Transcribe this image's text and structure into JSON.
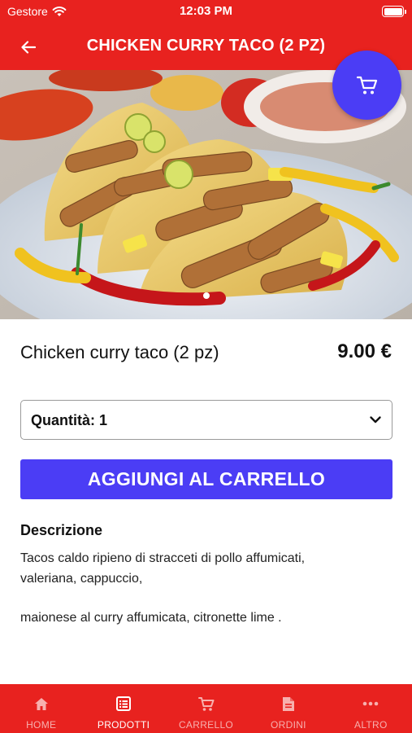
{
  "status_bar": {
    "carrier": "Gestore",
    "time": "12:03 PM"
  },
  "header": {
    "title": "CHICKEN CURRY TACO (2 PZ)",
    "back_icon": "back-arrow-icon"
  },
  "cart_button": {
    "icon": "cart-icon"
  },
  "product": {
    "name": "Chicken curry taco (2 pz)",
    "price": "9.00 €"
  },
  "quantity": {
    "label": "Quantità: 1"
  },
  "actions": {
    "add_to_cart_label": "AGGIUNGI AL CARRELLO"
  },
  "description": {
    "title": "Descrizione",
    "lines": [
      "Tacos caldo ripieno di  stracceti di pollo affumicati,",
      "valeriana, cappuccio,",
      "maionese al curry affumicata, citronette lime ."
    ]
  },
  "tabs": [
    {
      "label": "HOME",
      "icon": "home-icon",
      "active": false
    },
    {
      "label": "PRODOTTI",
      "icon": "list-icon",
      "active": true
    },
    {
      "label": "CARRELLO",
      "icon": "cart-icon",
      "active": false
    },
    {
      "label": "ORDINI",
      "icon": "document-icon",
      "active": false
    },
    {
      "label": "ALTRO",
      "icon": "more-icon",
      "active": false
    }
  ],
  "colors": {
    "brand_red": "#e8221f",
    "accent_purple": "#4b3df5"
  }
}
